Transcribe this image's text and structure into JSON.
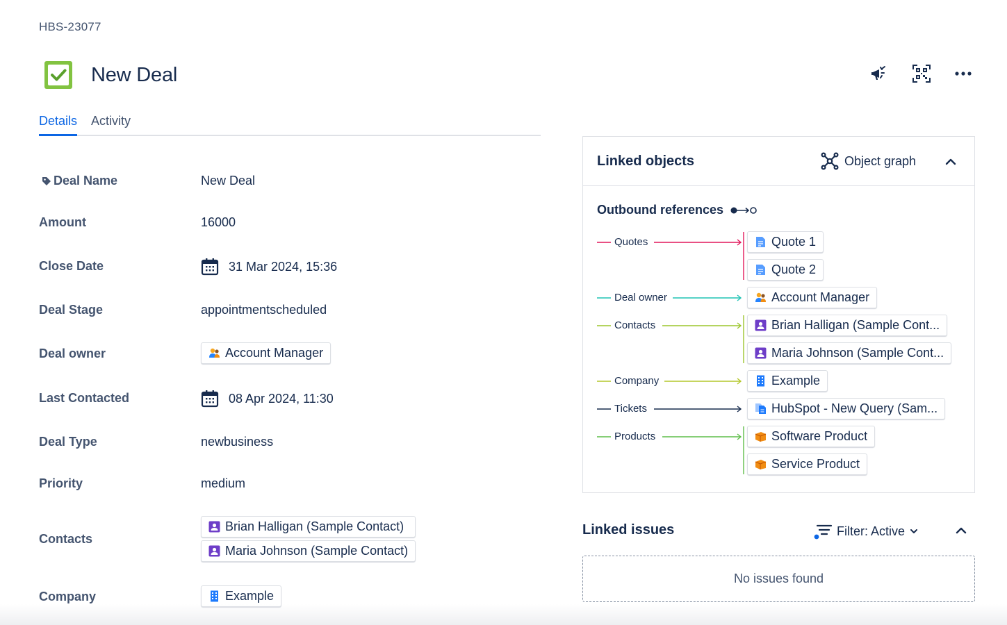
{
  "issue": {
    "key": "HBS-23077",
    "title": "New Deal"
  },
  "tabs": [
    {
      "label": "Details",
      "active": true
    },
    {
      "label": "Activity",
      "active": false
    }
  ],
  "fields": {
    "deal_name": {
      "label": "Deal Name",
      "value": "New Deal"
    },
    "amount": {
      "label": "Amount",
      "value": "16000"
    },
    "close_date": {
      "label": "Close Date",
      "value": "31 Mar 2024, 15:36"
    },
    "deal_stage": {
      "label": "Deal Stage",
      "value": "appointmentscheduled"
    },
    "deal_owner": {
      "label": "Deal owner",
      "value": "Account Manager"
    },
    "last_contacted": {
      "label": "Last Contacted",
      "value": "08 Apr 2024, 11:30"
    },
    "deal_type": {
      "label": "Deal Type",
      "value": "newbusiness"
    },
    "priority": {
      "label": "Priority",
      "value": "medium"
    },
    "contacts": {
      "label": "Contacts",
      "values": [
        "Brian Halligan (Sample Contact)",
        "Maria Johnson (Sample Contact)"
      ]
    },
    "company": {
      "label": "Company",
      "value": "Example"
    }
  },
  "linked_objects": {
    "title": "Linked objects",
    "object_graph_label": "Object graph",
    "outbound_label": "Outbound references",
    "refs": {
      "quotes": {
        "label": "Quotes",
        "color": "#e2175a",
        "items": [
          "Quote 1",
          "Quote 2"
        ]
      },
      "deal_owner": {
        "label": "Deal owner",
        "color": "#1fc2b4",
        "items": [
          "Account Manager"
        ]
      },
      "contacts": {
        "label": "Contacts",
        "color": "#9cc52c",
        "items": [
          "Brian Halligan (Sample Cont...",
          "Maria Johnson (Sample Cont..."
        ]
      },
      "company": {
        "label": "Company",
        "color": "#b4c72a",
        "items": [
          "Example"
        ]
      },
      "tickets": {
        "label": "Tickets",
        "color": "#172b4d",
        "items": [
          "HubSpot - New Query (Sam..."
        ]
      },
      "products": {
        "label": "Products",
        "color": "#5fbd4a",
        "items": [
          "Software Product",
          "Service Product"
        ]
      }
    }
  },
  "linked_issues": {
    "title": "Linked issues",
    "filter_label": "Filter: Active",
    "empty_text": "No issues found"
  },
  "colors": {
    "accent": "#0c66e4",
    "type_icon": "#82c341",
    "contact_icon": "#6e3ec8",
    "company_icon": "#1d7afc",
    "product_icon": "#f18d13",
    "quote_icon": "#579dff"
  }
}
